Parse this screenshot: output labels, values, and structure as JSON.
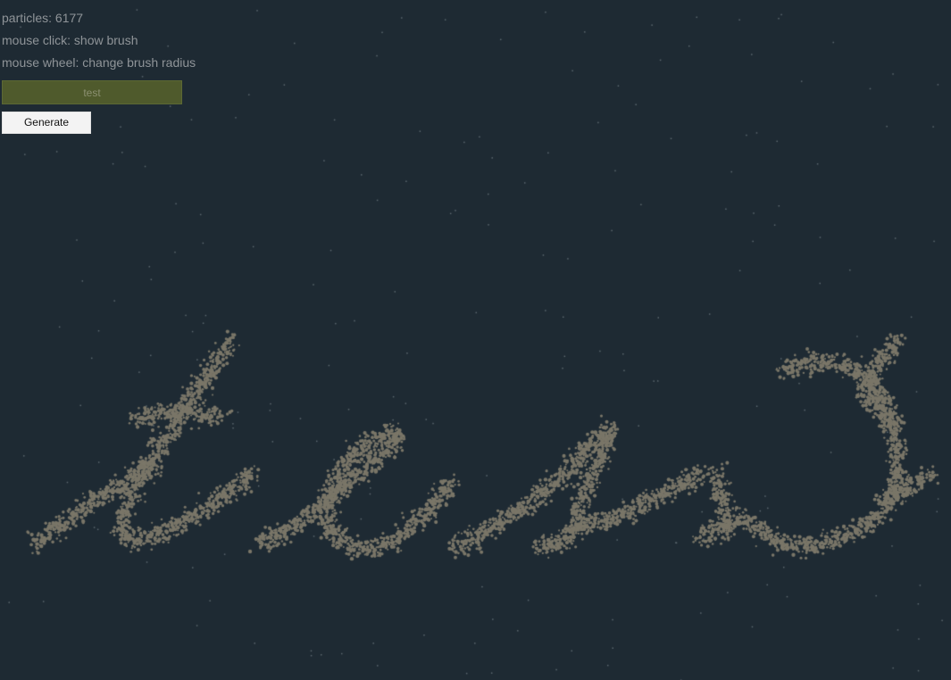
{
  "hud": {
    "particles_label": "particles: 6177",
    "hint_click": "mouse click: show brush",
    "hint_wheel": "mouse wheel: change brush radius"
  },
  "controls": {
    "text_value": "test",
    "generate_label": "Generate"
  },
  "canvas": {
    "word": "test",
    "particle_count": 6177,
    "colors": {
      "background": "#1e2a33",
      "particle": "#7a7668",
      "stray_particle": "#5d6970"
    }
  }
}
